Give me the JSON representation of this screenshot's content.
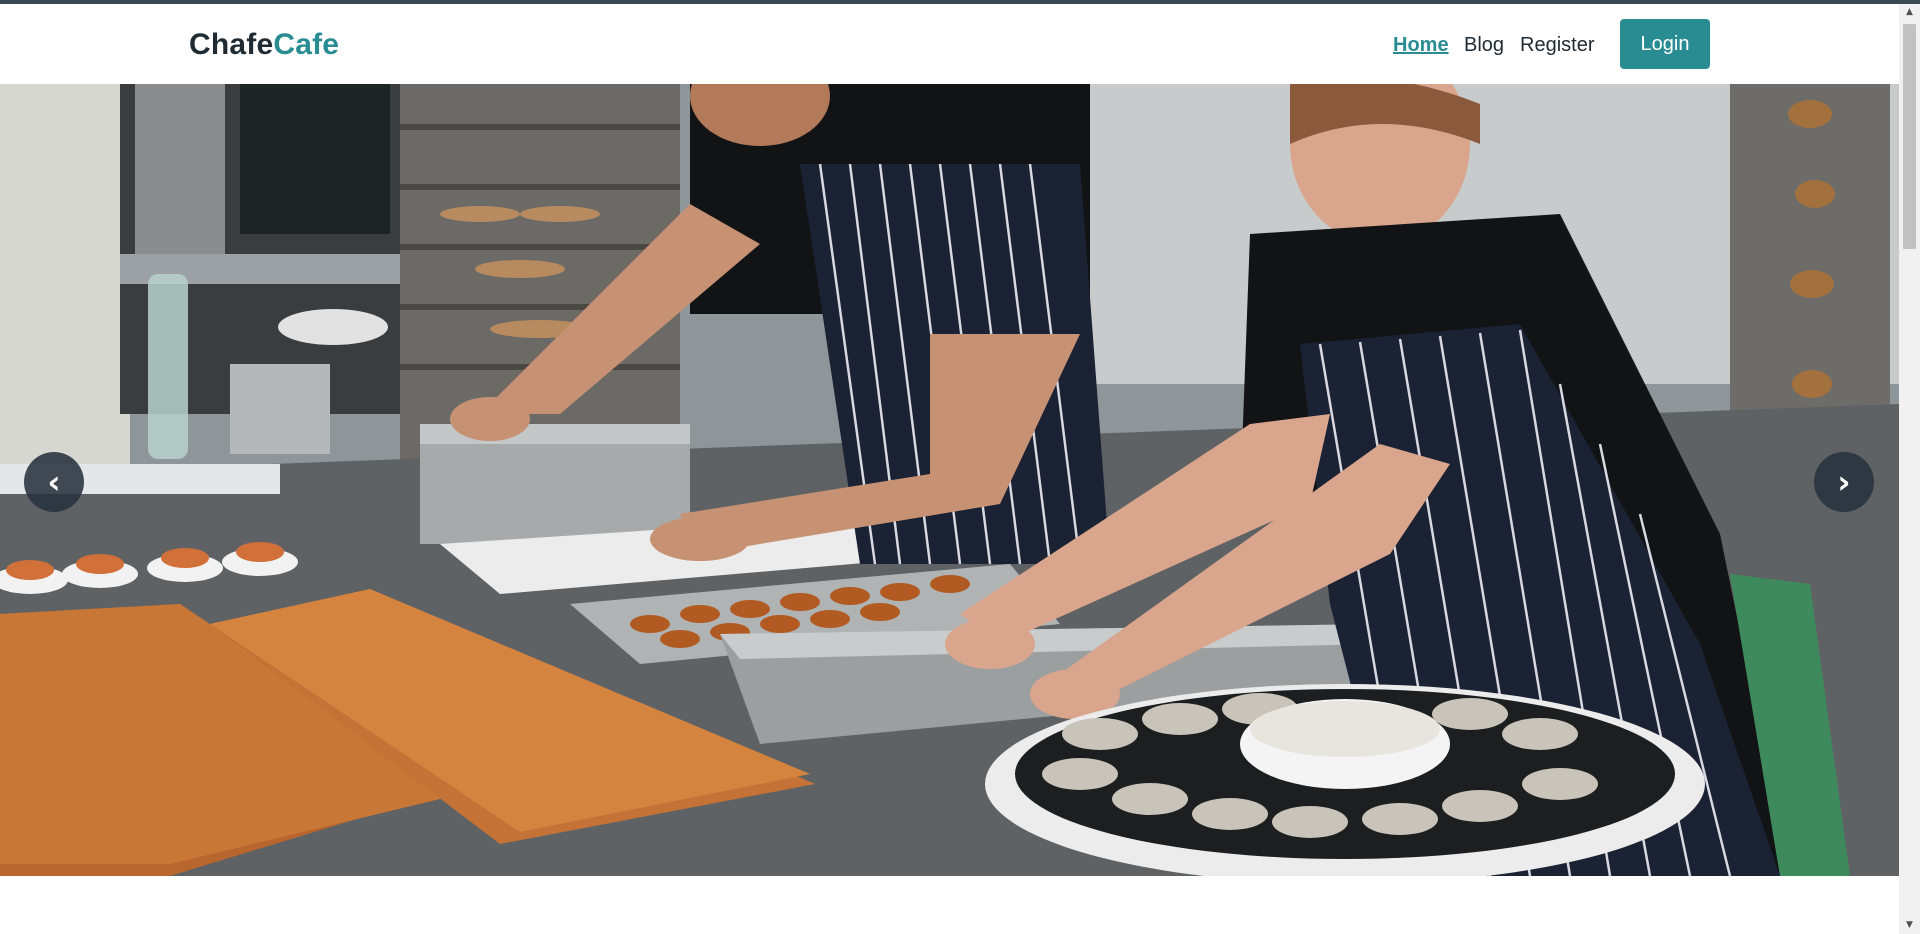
{
  "brand": {
    "part1": "Chafe",
    "part2": "Cafe",
    "colors": {
      "dark": "#1f2a33",
      "accent": "#2a8c93"
    }
  },
  "nav": {
    "items": [
      {
        "label": "Home",
        "active": true
      },
      {
        "label": "Blog",
        "active": false
      },
      {
        "label": "Register",
        "active": false
      }
    ],
    "login_label": "Login"
  },
  "hero": {
    "prev_icon": "‹",
    "next_icon": "›",
    "image": "kitchen-chefs-photo"
  },
  "scrollbar": {
    "up_icon": "▲",
    "down_icon": "▼"
  }
}
